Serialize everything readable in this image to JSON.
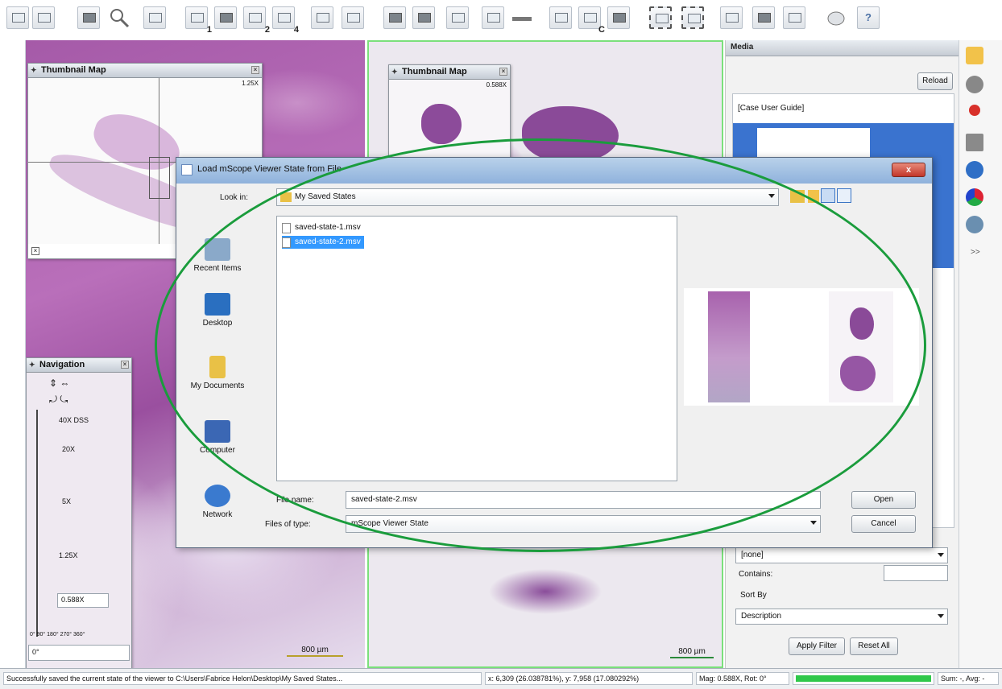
{
  "toolbar": {
    "labels": [
      "1",
      "2",
      "4",
      "C",
      "?"
    ]
  },
  "thumbnail_left": {
    "title": "Thumbnail Map",
    "zoom": "1.25X"
  },
  "thumbnail_center": {
    "title": "Thumbnail Map",
    "zoom": "0.588X"
  },
  "navigation": {
    "title": "Navigation",
    "levels": [
      "40X DSS",
      "20X",
      "5X",
      "1.25X"
    ],
    "magnification": "0.588X",
    "angles": "0° 90° 180° 270° 360°",
    "rotation": "0°"
  },
  "scale_left": "800 µm",
  "scale_center": "800 µm",
  "media_panel": {
    "title": "Media",
    "reload": "Reload",
    "item": "[Case User Guide]",
    "filter_value": "[none]",
    "contains_label": "Contains:",
    "sort_by_label": "Sort By",
    "sort_value": "Description",
    "apply_filter": "Apply Filter",
    "reset_all": "Reset All",
    "expand": ">>"
  },
  "dialog": {
    "title": "Load mScope Viewer State from File",
    "close": "x",
    "look_in_label": "Look in:",
    "look_in_value": "My Saved States",
    "places": [
      "Recent Items",
      "Desktop",
      "My Documents",
      "Computer",
      "Network"
    ],
    "files": [
      "saved-state-1.msv",
      "saved-state-2.msv"
    ],
    "file_name_label": "File name:",
    "file_name_value": "saved-state-2.msv",
    "files_of_type_label": "Files of type:",
    "files_of_type_value": "mScope Viewer State",
    "open": "Open",
    "cancel": "Cancel"
  },
  "status": {
    "message": "Successfully saved the current state of the viewer to C:\\Users\\Fabrice Helon\\Desktop\\My Saved States...",
    "coords": "x: 6,309 (26.038781%), y: 7,958 (17.080292%)",
    "mag": "Mag: 0.588X, Rot: 0°",
    "sum": "Sum: -, Avg: -"
  },
  "colors": {
    "highlight_ring": "#1a9c3c",
    "selected_file": "#3399ff",
    "active_view_border": "#7be07b"
  }
}
